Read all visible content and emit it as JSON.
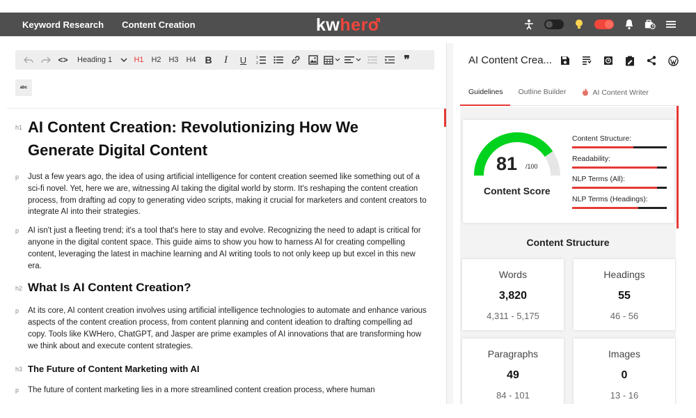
{
  "header": {
    "nav": [
      "Keyword Research",
      "Content Creation"
    ],
    "logo": {
      "part1": "kw",
      "part2": "hero"
    }
  },
  "toolbar": {
    "heading_select": "Heading 1",
    "h1": "H1",
    "h2": "H2",
    "h3": "H3",
    "h4": "H4",
    "bold": "B",
    "italic": "I",
    "underline": "U",
    "source": "<>",
    "quote": "❞",
    "case_button": "abc"
  },
  "document": {
    "blocks": [
      {
        "tag": "h1",
        "text": "AI Content Creation: Revolutionizing How We Generate Digital Content"
      },
      {
        "tag": "p",
        "text": "Just a few years ago, the idea of using artificial intelligence for content creation seemed like something out of a sci-fi novel. Yet, here we are, witnessing AI taking the digital world by storm. It's reshaping the content creation process, from drafting ad copy to generating video scripts, making it crucial for marketers and content creators to integrate AI into their strategies."
      },
      {
        "tag": "p",
        "text": "AI isn't just a fleeting trend; it's a tool that's here to stay and evolve. Recognizing the need to adapt is critical for anyone in the digital content space. This guide aims to show you how to harness AI for creating compelling content, leveraging the latest in machine learning and AI writing tools to not only keep up but excel in this new era."
      },
      {
        "tag": "h2",
        "text": "What Is AI Content Creation?"
      },
      {
        "tag": "p",
        "text": "At its core, AI content creation involves using artificial intelligence technologies to automate and enhance various aspects of the content creation process, from content planning and content ideation to drafting compelling ad copy. Tools like KWHero, ChatGPT, and Jasper are prime examples of AI innovations that are transforming how we think about and execute content strategies."
      },
      {
        "tag": "h3",
        "text": "The Future of Content Marketing with AI"
      },
      {
        "tag": "p",
        "text": "The future of content marketing lies in a more streamlined content creation process, where human"
      }
    ]
  },
  "panel": {
    "title": "AI Content Crea...",
    "tabs": [
      "Guidelines",
      "Outline Builder",
      "AI Content Writer"
    ],
    "score": {
      "value": 81,
      "max_label": "/100",
      "label": "Content Score",
      "gauge_fraction": 0.81
    },
    "metrics": [
      {
        "label": "Content Structure:",
        "fill": 0.65
      },
      {
        "label": "Readability:",
        "fill": 0.9
      },
      {
        "label": "NLP Terms (All):",
        "fill": 0.9
      },
      {
        "label": "NLP Terms (Headings):",
        "fill": 0.7
      }
    ],
    "structure_title": "Content Structure",
    "stats": [
      {
        "label": "Words",
        "value": "3,820",
        "range": "4,311  - 5,175"
      },
      {
        "label": "Headings",
        "value": "55",
        "range": "46  - 56"
      },
      {
        "label": "Paragraphs",
        "value": "49",
        "range": "84  - 101"
      },
      {
        "label": "Images",
        "value": "0",
        "range": "13  - 16"
      }
    ]
  },
  "colors": {
    "accent": "#e53935",
    "gauge_green": "#00d21e",
    "header_bg": "#4f4f4f"
  }
}
